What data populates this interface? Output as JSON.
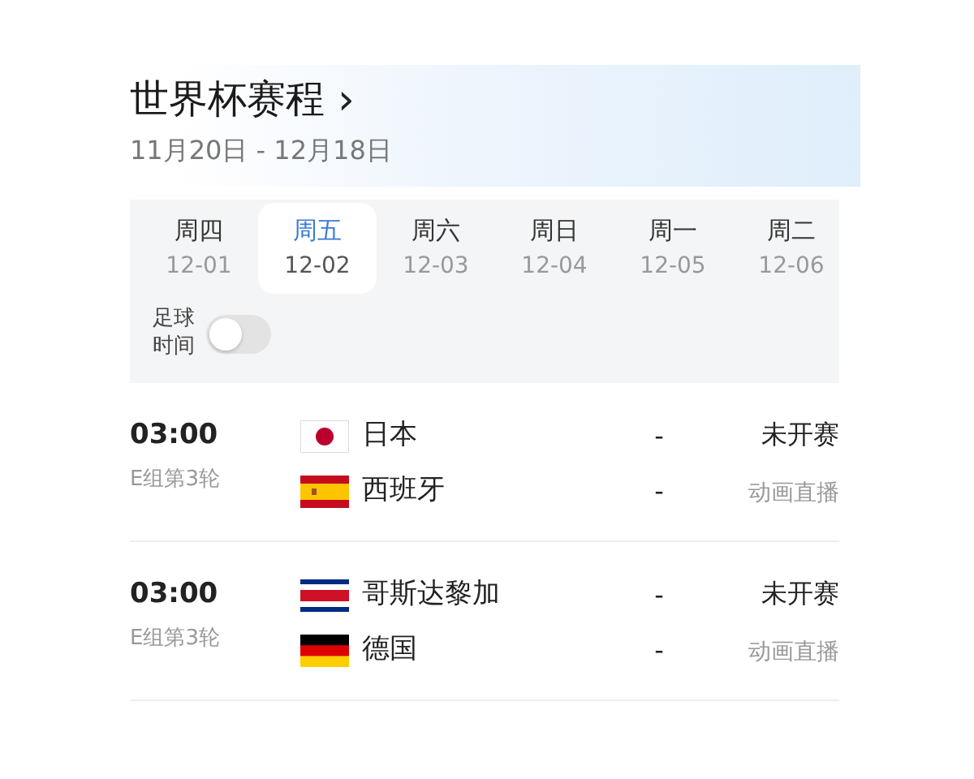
{
  "header": {
    "title": "世界杯赛程",
    "chevron": "›",
    "date_range": "11月20日 - 12月18日"
  },
  "days": [
    {
      "weekday": "周四",
      "date": "12-01",
      "selected": false
    },
    {
      "weekday": "周五",
      "date": "12-02",
      "selected": true
    },
    {
      "weekday": "周六",
      "date": "12-03",
      "selected": false
    },
    {
      "weekday": "周日",
      "date": "12-04",
      "selected": false
    },
    {
      "weekday": "周一",
      "date": "12-05",
      "selected": false
    },
    {
      "weekday": "周二",
      "date": "12-06",
      "selected": false
    }
  ],
  "football_time": {
    "label": "足球时间",
    "on": false
  },
  "matches": [
    {
      "time": "03:00",
      "round": "E组第3轮",
      "status": "未开赛",
      "broadcast": "动画直播",
      "teams": [
        {
          "name": "日本",
          "kind": "japan",
          "score": "-"
        },
        {
          "name": "西班牙",
          "kind": "spain",
          "score": "-"
        }
      ]
    },
    {
      "time": "03:00",
      "round": "E组第3轮",
      "status": "未开赛",
      "broadcast": "动画直播",
      "teams": [
        {
          "name": "哥斯达黎加",
          "kind": "costarica",
          "score": "-"
        },
        {
          "name": "德国",
          "kind": "germany",
          "score": "-"
        }
      ]
    }
  ]
}
